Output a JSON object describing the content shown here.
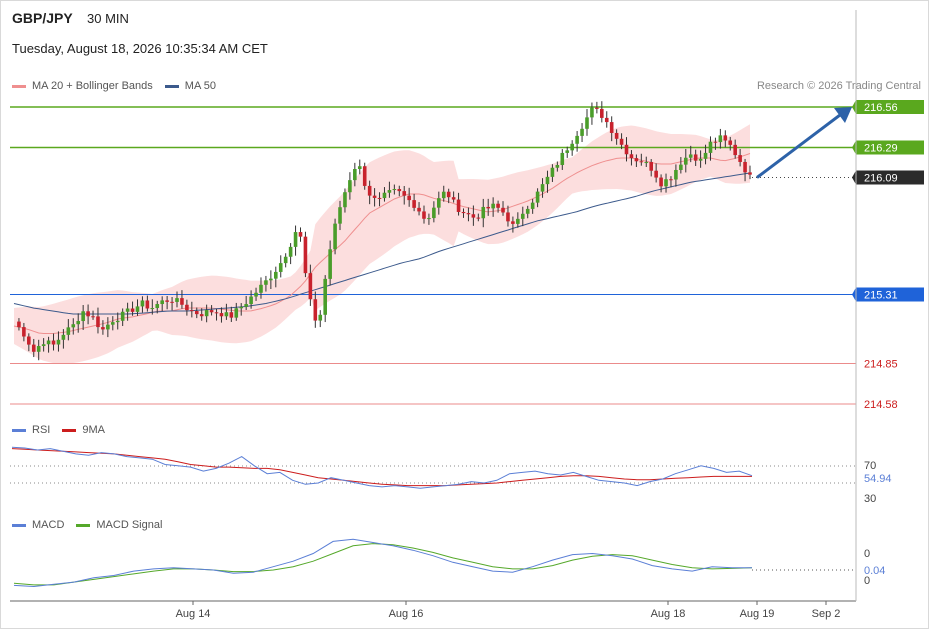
{
  "header": {
    "symbol": "GBP/JPY",
    "timeframe": "30 MIN",
    "datetime": "Tuesday, August 18, 2026 10:35:34 AM CET",
    "credit": "Research © 2026 Trading Central"
  },
  "colors": {
    "up": "#4a9d2a",
    "down": "#c8222d",
    "bands_fill": "#fbd3d3",
    "ma20": "#ef8f8f",
    "ma50": "#3c5a8c",
    "resistance": "#5aa81e",
    "support": "#1f63d9",
    "target": "#eb8b8b",
    "arrow": "#2d62a8",
    "rsi": "#5b7fd6",
    "rsi_ma": "#cc1d1d",
    "macd": "#5b7fd6",
    "macd_signal": "#55a82a"
  },
  "chart_data": [
    {
      "type": "candlestick",
      "title": "GBP/JPY",
      "legend": [
        {
          "name": "MA 20 + Bollinger Bands",
          "color": "#ef8f8f"
        },
        {
          "name": "MA 50",
          "color": "#3c5a8c"
        }
      ],
      "legend_placement": "top-left",
      "x_ticks": [
        "Aug 14",
        "Aug 16",
        "Aug 18",
        "Aug 19",
        "Sep 2"
      ],
      "levels": [
        {
          "value": 216.56,
          "label": "216.56",
          "kind": "resistance"
        },
        {
          "value": 216.29,
          "label": "216.29",
          "kind": "resistance"
        },
        {
          "value": 216.09,
          "label": "216.09",
          "kind": "current"
        },
        {
          "value": 215.31,
          "label": "215.31",
          "kind": "support"
        },
        {
          "value": 214.85,
          "label": "214.85",
          "kind": "target"
        },
        {
          "value": 214.58,
          "label": "214.58",
          "kind": "target"
        }
      ],
      "close_path": [
        215.13,
        215.05,
        214.93,
        215.0,
        214.97,
        215.05,
        215.1,
        215.2,
        215.16,
        215.07,
        215.14,
        215.17,
        215.21,
        215.25,
        215.22,
        215.26,
        215.28,
        215.25,
        215.2,
        215.18,
        215.2,
        215.19,
        215.16,
        215.22,
        215.28,
        215.35,
        215.42,
        215.5,
        215.62,
        215.78,
        215.3,
        215.08,
        215.55,
        215.85,
        216.05,
        216.2,
        216.0,
        215.92,
        215.98,
        216.0,
        215.95,
        215.9,
        215.8,
        215.92,
        216.0,
        215.9,
        215.85,
        215.82,
        215.88,
        215.9,
        215.85,
        215.75,
        215.88,
        215.95,
        216.05,
        216.15,
        216.25,
        216.35,
        216.45,
        216.55,
        216.5,
        216.4,
        216.3,
        216.22,
        216.2,
        216.15,
        216.05,
        216.1,
        216.2,
        216.25,
        216.2,
        216.32,
        216.35,
        216.3,
        216.2,
        216.09
      ],
      "ma20_path": [
        215.1,
        215.08,
        215.05,
        215.05,
        215.06,
        215.08,
        215.1,
        215.12,
        215.15,
        215.16,
        215.18,
        215.2,
        215.2,
        215.22,
        215.22,
        215.22,
        215.21,
        215.2,
        215.2,
        215.22,
        215.25,
        215.3,
        215.38,
        215.5,
        215.58,
        215.65,
        215.75,
        215.85,
        215.9,
        215.95,
        215.98,
        215.98,
        215.95,
        215.93,
        215.9,
        215.88,
        215.86,
        215.87,
        215.9,
        215.93,
        215.97,
        216.02,
        216.08,
        216.13,
        216.17,
        216.2,
        216.22,
        216.22,
        216.2,
        216.18,
        216.18,
        216.2,
        216.22,
        216.22,
        216.2,
        216.22,
        216.25
      ],
      "ma50_path": [
        215.25,
        215.22,
        215.2,
        215.18,
        215.18,
        215.18,
        215.18,
        215.19,
        215.2,
        215.2,
        215.21,
        215.22,
        215.23,
        215.25,
        215.28,
        215.32,
        215.36,
        215.4,
        215.44,
        215.48,
        215.52,
        215.55,
        215.6,
        215.64,
        215.68,
        215.72,
        215.76,
        215.8,
        215.83,
        215.86,
        215.9,
        215.93,
        215.96,
        216.0,
        216.03,
        216.06,
        216.08,
        216.1,
        216.12
      ]
    },
    {
      "type": "line",
      "legend": [
        {
          "name": "RSI",
          "color": "#5b7fd6"
        },
        {
          "name": "9MA",
          "color": "#cc1d1d"
        }
      ],
      "y_ticks": [
        "70",
        "30"
      ],
      "last_value": "54.94",
      "series": [
        {
          "name": "RSI",
          "values": [
            98,
            97,
            94,
            96,
            92,
            88,
            86,
            90,
            88,
            84,
            82,
            80,
            72,
            70,
            68,
            62,
            66,
            74,
            84,
            70,
            58,
            60,
            48,
            42,
            44,
            52,
            48,
            44,
            40,
            38,
            40,
            38,
            36,
            38,
            40,
            42,
            46,
            44,
            48,
            58,
            60,
            62,
            58,
            56,
            60,
            54,
            48,
            46,
            44,
            40,
            46,
            50,
            58,
            64,
            70,
            66,
            60,
            62,
            54.94
          ]
        },
        {
          "name": "9MA",
          "values": [
            96,
            95,
            94,
            93,
            92,
            91,
            90,
            89,
            88,
            86,
            84,
            82,
            80,
            76,
            72,
            70,
            68,
            68,
            67,
            66,
            66,
            64,
            60,
            56,
            52,
            50,
            48,
            46,
            44,
            42,
            41,
            40,
            40,
            40,
            40,
            41,
            42,
            43,
            44,
            46,
            48,
            50,
            52,
            54,
            55,
            55,
            54,
            52,
            50,
            49,
            49,
            50,
            51,
            52,
            53,
            54,
            54,
            54,
            54
          ]
        }
      ]
    },
    {
      "type": "line",
      "legend": [
        {
          "name": "MACD",
          "color": "#5b7fd6"
        },
        {
          "name": "MACD Signal",
          "color": "#55a82a"
        }
      ],
      "y_ticks": [
        "0",
        "0"
      ],
      "last_value": "0.04",
      "series": [
        {
          "name": "MACD",
          "values": [
            -0.28,
            -0.3,
            -0.26,
            -0.22,
            -0.14,
            -0.1,
            -0.02,
            0.02,
            0.04,
            0.02,
            0.0,
            -0.06,
            -0.04,
            0.06,
            0.16,
            0.3,
            0.52,
            0.56,
            0.5,
            0.44,
            0.36,
            0.26,
            0.14,
            0.06,
            -0.02,
            -0.04,
            0.06,
            0.18,
            0.28,
            0.3,
            0.26,
            0.2,
            0.08,
            0.02,
            -0.02,
            0.06,
            0.04,
            0.04
          ]
        },
        {
          "name": "MACD Signal",
          "values": [
            -0.24,
            -0.27,
            -0.27,
            -0.22,
            -0.17,
            -0.12,
            -0.07,
            -0.02,
            0.02,
            0.02,
            0.0,
            -0.03,
            -0.03,
            0.0,
            0.06,
            0.16,
            0.3,
            0.44,
            0.48,
            0.46,
            0.4,
            0.32,
            0.22,
            0.14,
            0.06,
            0.02,
            0.02,
            0.08,
            0.18,
            0.25,
            0.28,
            0.26,
            0.18,
            0.1,
            0.04,
            0.02,
            0.03,
            0.04
          ]
        }
      ]
    }
  ]
}
